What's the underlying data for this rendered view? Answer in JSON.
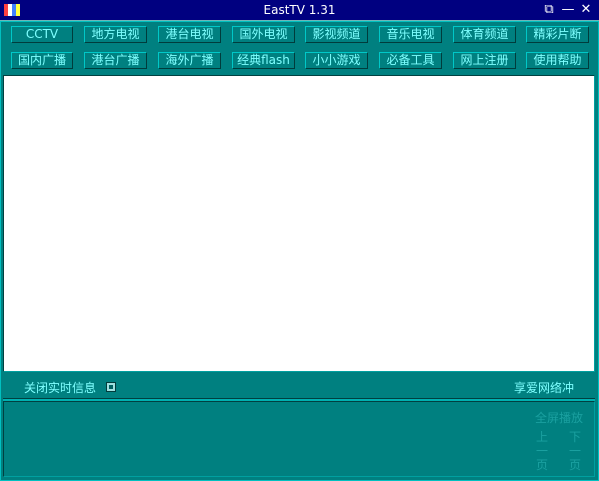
{
  "window": {
    "title": "EastTV 1.31",
    "controls": {
      "restore_glyph": "⧉",
      "minimize_glyph": "—",
      "close_glyph": "✕"
    }
  },
  "nav": {
    "row1": [
      "CCTV",
      "地方电视",
      "港台电视",
      "国外电视",
      "影视频道",
      "音乐电视",
      "体育频道",
      "精彩片断"
    ],
    "row2": [
      "国内广播",
      "港台广播",
      "海外广播",
      "经典flash",
      "小小游戏",
      "必备工具",
      "网上注册",
      "使用帮助"
    ]
  },
  "status_bar": {
    "realtime_label": "关闭实时信息",
    "buffer_label": "享爱网络冲"
  },
  "playback": {
    "fullscreen": "全屏播放",
    "prev": "上一页",
    "next": "下一页"
  },
  "colors": {
    "background": "#008080",
    "titlebar": "#000080",
    "button_text": "#7fffff",
    "disabled_text": "#1aa0a0"
  },
  "icons": {
    "app": "app-icon",
    "restore": "restore-icon",
    "minimize": "minimize-icon",
    "close": "close-icon"
  }
}
